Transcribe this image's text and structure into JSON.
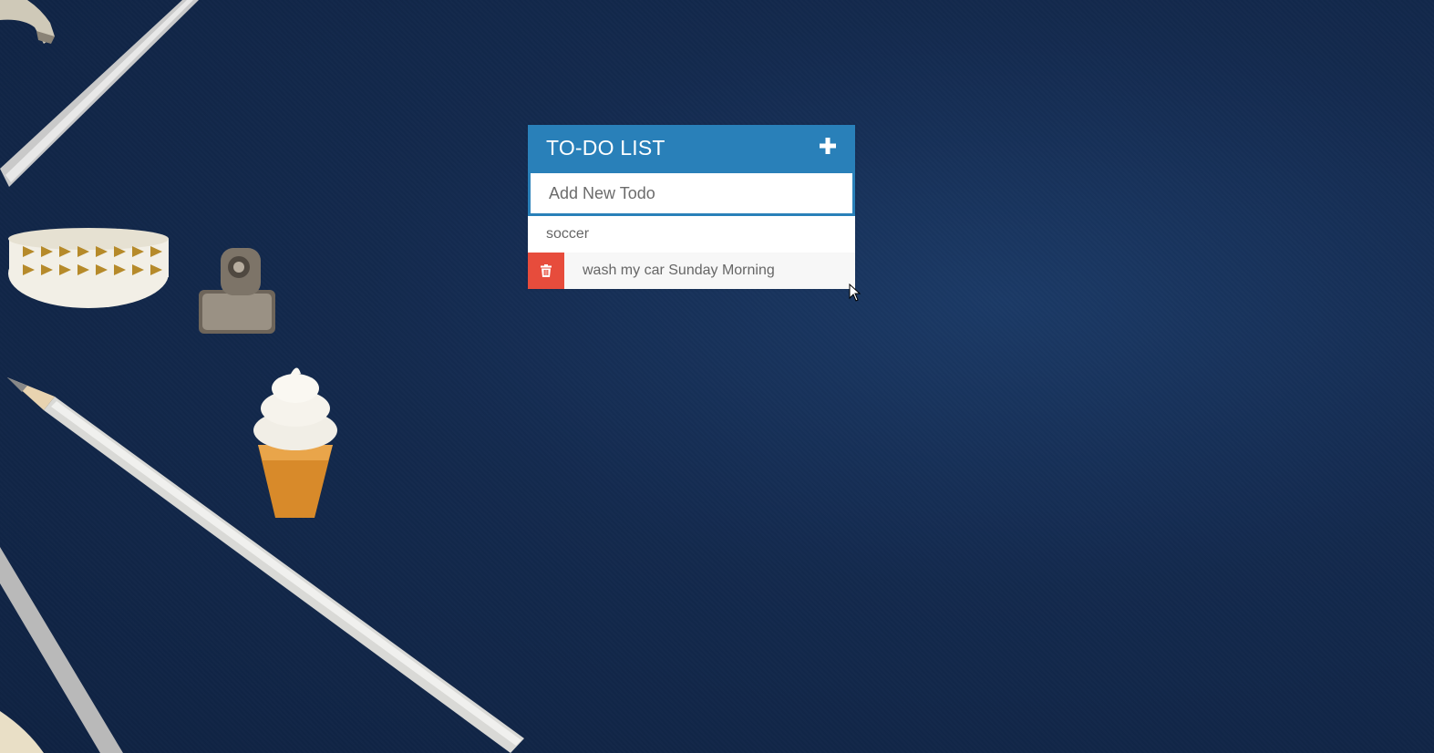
{
  "todo": {
    "title": "TO-DO LIST",
    "add_icon": "plus-icon",
    "input": {
      "placeholder": "Add New Todo",
      "value": ""
    },
    "items": [
      {
        "text": "soccer",
        "delete_visible": false
      },
      {
        "text": "wash my car Sunday Morning",
        "delete_visible": true,
        "delete_icon": "trash-icon"
      }
    ]
  },
  "colors": {
    "header": "#2980b9",
    "delete": "#e74c3c",
    "background": "#13294d"
  }
}
